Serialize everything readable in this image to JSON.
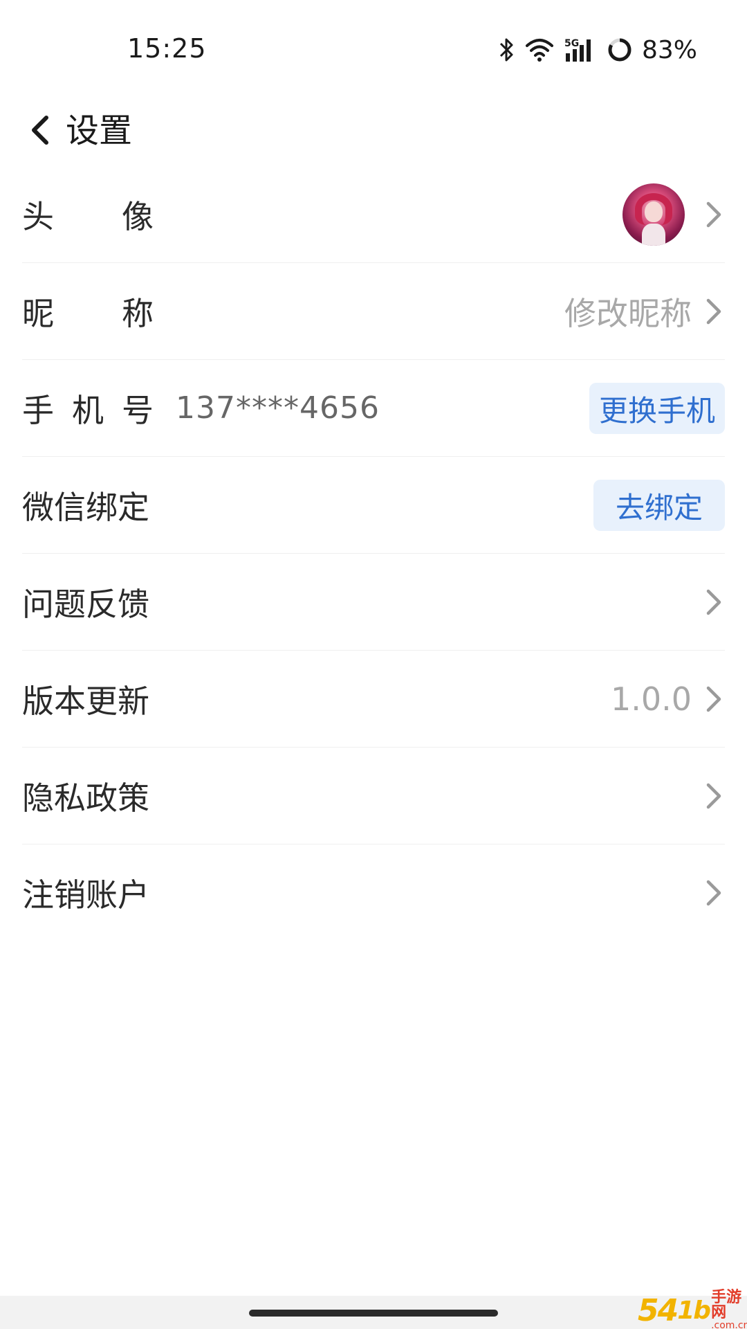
{
  "status_bar": {
    "time": "15:25",
    "battery": "83%",
    "icons": [
      "bluetooth-icon",
      "wifi-icon",
      "5g-signal-icon",
      "battery-ring-icon"
    ]
  },
  "header": {
    "title": "设置",
    "back_icon": "chevron-left-icon"
  },
  "settings": {
    "avatar": {
      "label_chars": [
        "头",
        "像"
      ]
    },
    "nickname": {
      "label_chars": [
        "昵",
        "称"
      ],
      "value": "修改昵称"
    },
    "phone": {
      "label_chars": [
        "手",
        "机",
        "号"
      ],
      "value": "137****4656",
      "button": "更换手机"
    },
    "wechat": {
      "label": "微信绑定",
      "button": "去绑定"
    },
    "feedback": {
      "label": "问题反馈"
    },
    "version": {
      "label": "版本更新",
      "value": "1.0.0"
    },
    "privacy": {
      "label": "隐私政策"
    },
    "delete_account": {
      "label": "注销账户"
    }
  },
  "watermark": {
    "number": "54",
    "suffix": "1b",
    "text": "手游网",
    "domain": ".com.cn"
  },
  "colors": {
    "accent": "#2f6fcf",
    "pill_bg": "#e8f1fc",
    "muted_text": "#a8a8a8",
    "divider": "#efefef"
  }
}
